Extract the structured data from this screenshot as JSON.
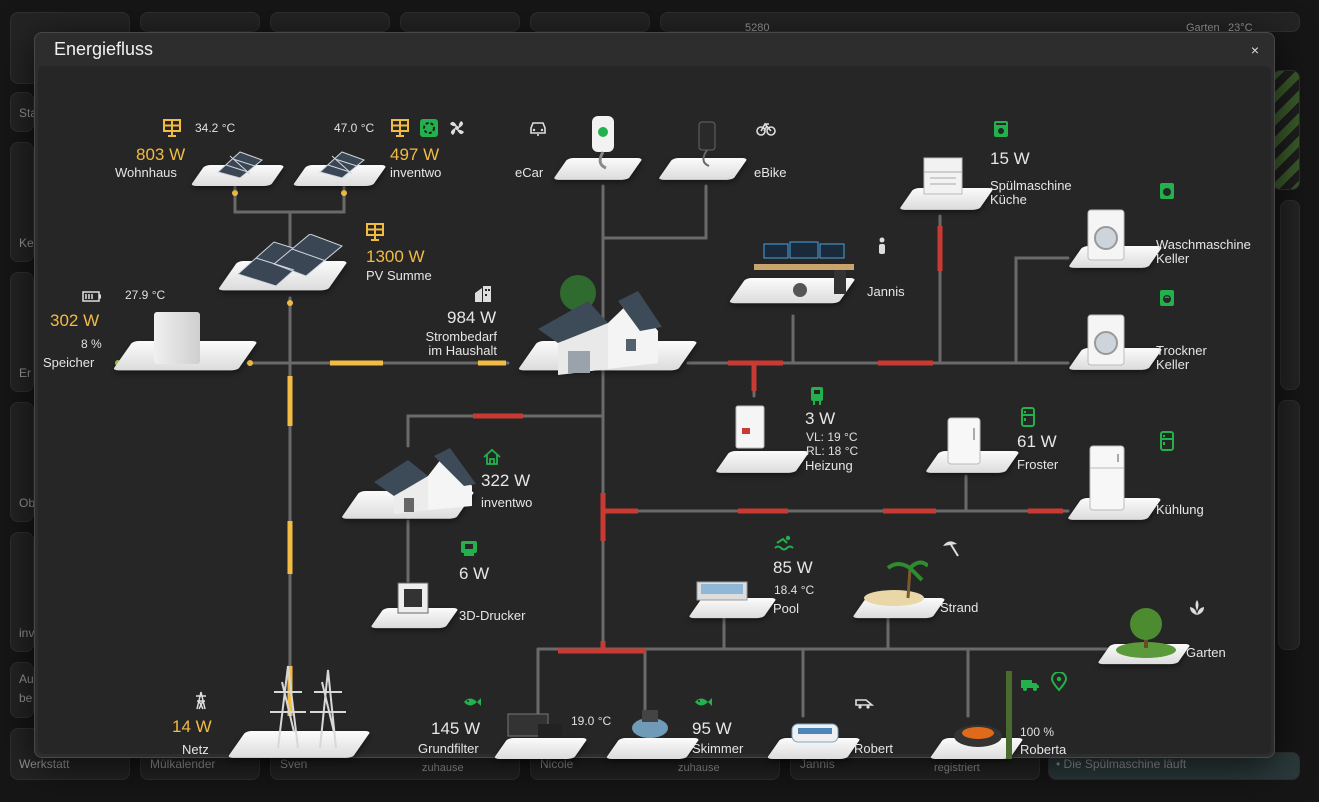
{
  "dialog": {
    "title": "Energiefluss",
    "close_label": "×"
  },
  "background": {
    "left_labels": [
      "Sta",
      "Ke",
      "Er",
      "Ob",
      "inv",
      "Au",
      "be",
      "Werkstatt"
    ],
    "top_labels": [
      "5280",
      "Garten",
      "23°C"
    ],
    "bottom_tiles": [
      "Mülkalender",
      "Sven",
      "zuhause",
      "Nicole",
      "zuhause",
      "Jannis",
      "registriert",
      "• Die Spülmaschine läuft"
    ]
  },
  "nodes": {
    "pv_wohnhaus": {
      "value": "803 W",
      "label": "Wohnhaus",
      "temp": "34.2 °C"
    },
    "pv_inventwo": {
      "value": "497 W",
      "label": "inventwo",
      "temp": "47.0 °C"
    },
    "pv_summe": {
      "value": "1300 W",
      "label": "PV Summe"
    },
    "speicher": {
      "value": "302 W",
      "label": "Speicher",
      "temp": "27.9 °C",
      "soc": "8 %"
    },
    "haushalt": {
      "value": "984 W",
      "label1": "Strombedarf",
      "label2": "im Haushalt"
    },
    "ecar": {
      "label": "eCar"
    },
    "ebike": {
      "label": "eBike"
    },
    "spuelmaschine": {
      "value": "15 W",
      "label1": "Spülmaschine",
      "label2": "Küche"
    },
    "waschmaschine": {
      "label1": "Waschmaschine",
      "label2": "Keller"
    },
    "jannis": {
      "label": "Jannis"
    },
    "trockner": {
      "label1": "Trockner",
      "label2": "Keller"
    },
    "heizung": {
      "value": "3 W",
      "vl": "VL: 19 °C",
      "rl": "RL: 18 °C",
      "label": "Heizung"
    },
    "froster": {
      "value": "61 W",
      "label": "Froster"
    },
    "kuehlung": {
      "label": "Kühlung"
    },
    "inventwo_house": {
      "value": "322 W",
      "label": "inventwo"
    },
    "drucker": {
      "value": "6 W",
      "label": "3D-Drucker"
    },
    "pool": {
      "value": "85 W",
      "temp": "18.4 °C",
      "label": "Pool"
    },
    "strand": {
      "label": "Strand"
    },
    "garten": {
      "label": "Garten"
    },
    "netz": {
      "value": "14 W",
      "label": "Netz"
    },
    "grundfilter": {
      "value": "145 W",
      "label": "Grundfilter",
      "temp": "19.0 °C"
    },
    "skimmer": {
      "value": "95 W",
      "label": "Skimmer"
    },
    "robert": {
      "label": "Robert"
    },
    "roberta": {
      "value": "100 %",
      "label": "Roberta"
    }
  },
  "colors": {
    "accent_yellow": "#f2bb43",
    "flow_red": "#c83a32",
    "flow_yellow": "#f2bb43",
    "icon_green": "#22b14c",
    "line_gray": "#6a6a6a"
  }
}
